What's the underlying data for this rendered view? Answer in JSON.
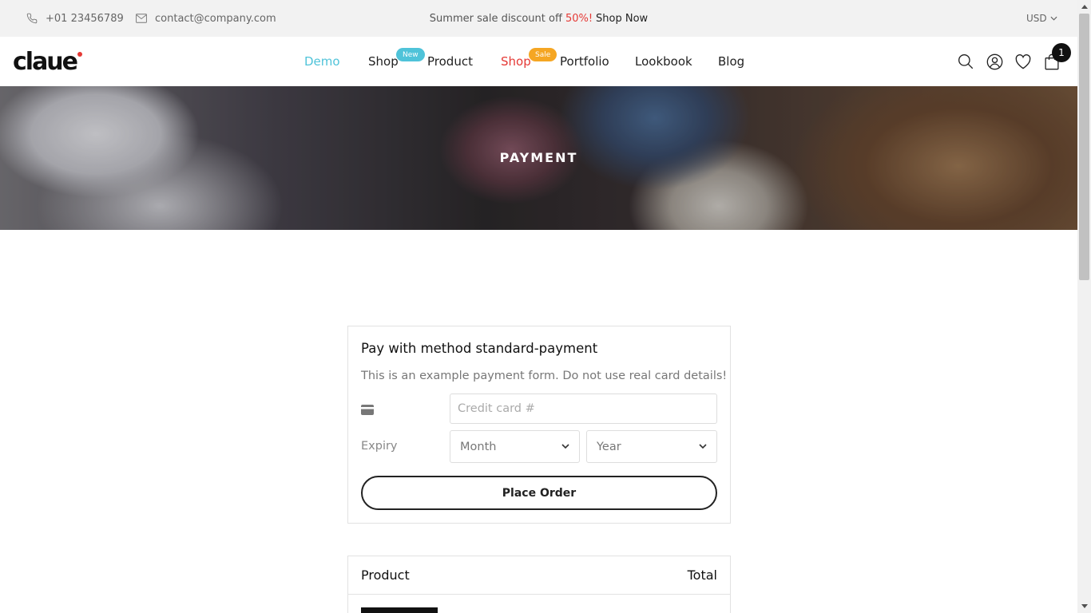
{
  "topbar": {
    "phone": "+01 23456789",
    "email": "contact@company.com",
    "promo_text": "Summer sale discount off",
    "promo_percent": "50%!",
    "promo_link": "Shop Now",
    "currency": "USD"
  },
  "header": {
    "logo": "claue",
    "nav": [
      {
        "label": "Demo",
        "badge": ""
      },
      {
        "label": "Shop",
        "badge": "New"
      },
      {
        "label": "Product",
        "badge": ""
      },
      {
        "label": "Shop",
        "badge": "Sale"
      },
      {
        "label": "Portfolio",
        "badge": ""
      },
      {
        "label": "Lookbook",
        "badge": ""
      },
      {
        "label": "Blog",
        "badge": ""
      }
    ],
    "icons": [
      "search-icon",
      "account-icon",
      "wishlist-heart-icon",
      "cart-bag-icon"
    ],
    "cart_count": "1"
  },
  "banner": {
    "title": "PAYMENT"
  },
  "payment": {
    "title": "Pay with method standard-payment",
    "note": "This is an example payment form. Do not use real card details!",
    "card_placeholder": "Credit card #",
    "expiry_label": "Expiry",
    "month_value": "Month",
    "year_value": "Year",
    "place_order": "Place Order"
  },
  "order": {
    "col_product": "Product",
    "col_total": "Total"
  },
  "colors": {
    "accent": "#4fc3d9",
    "sale": "#f5a623",
    "red": "#e53935"
  }
}
